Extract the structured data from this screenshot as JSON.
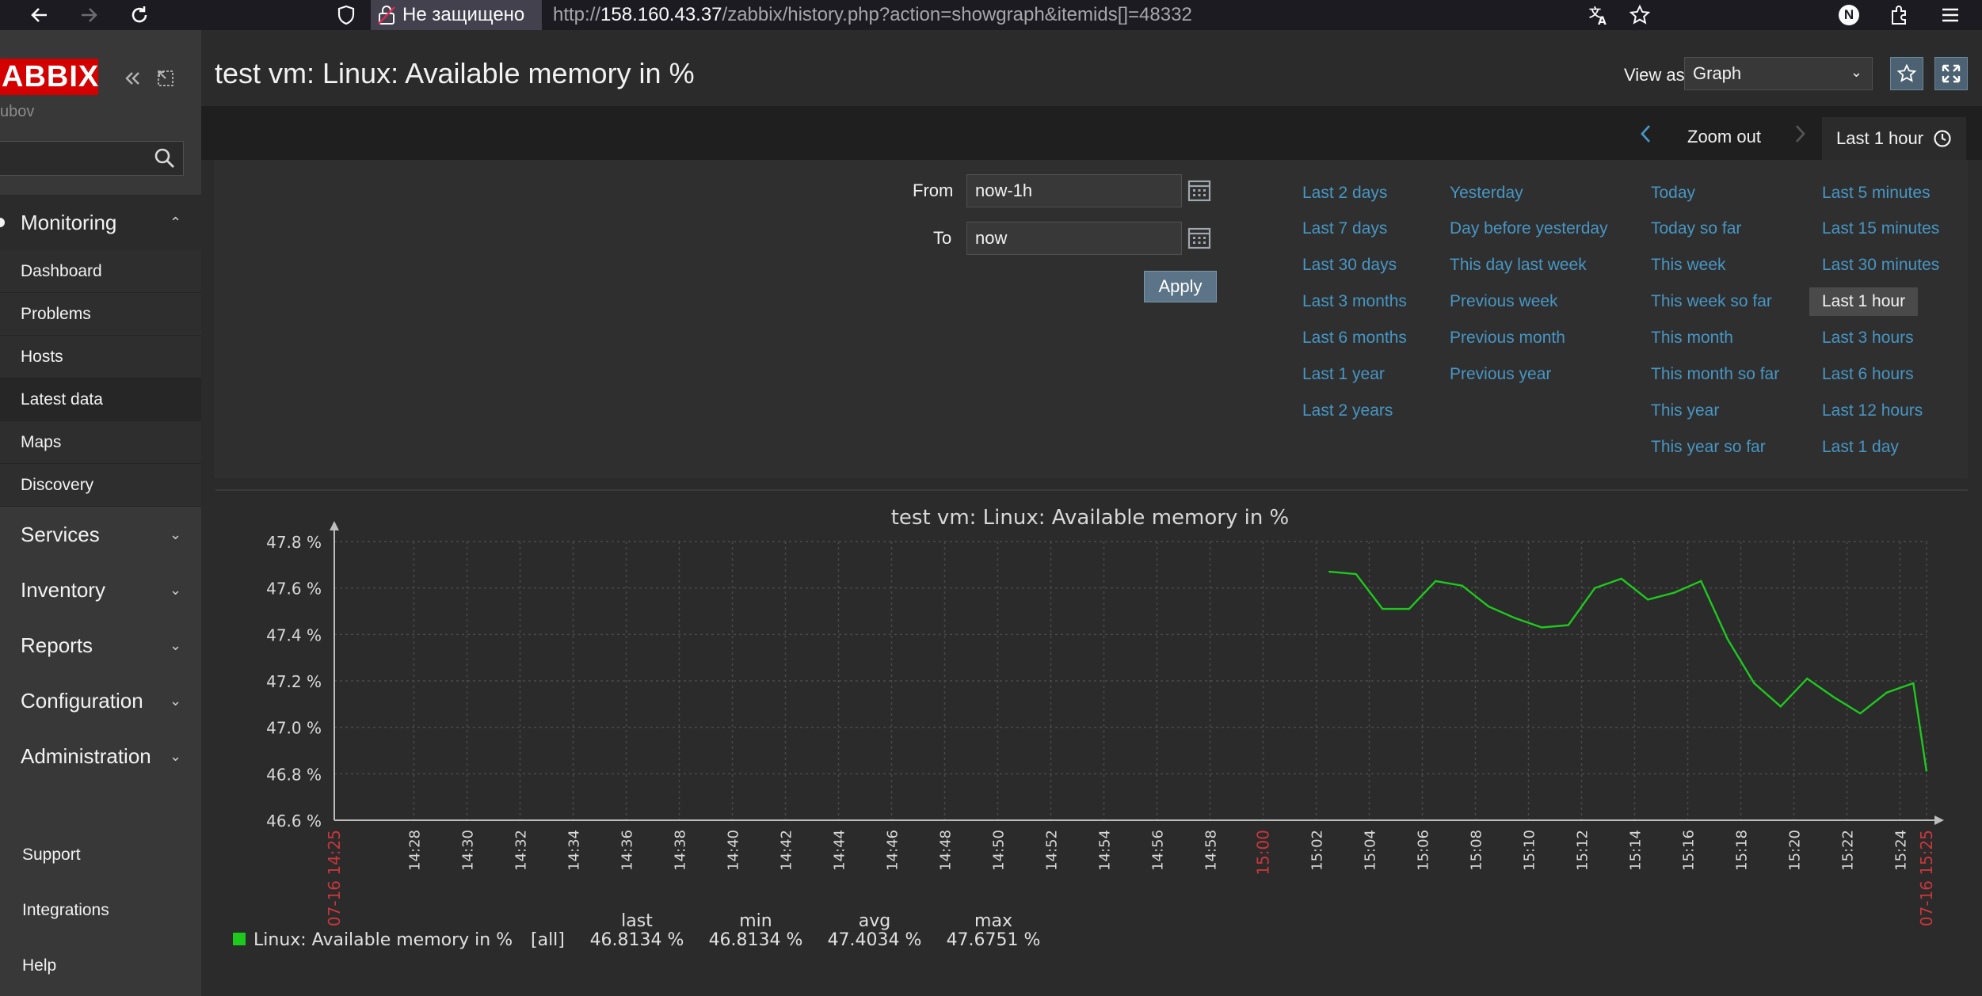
{
  "browser": {
    "security_text": "Не защищено",
    "url_host": "158.160.43.37",
    "url_prefix": "http://",
    "url_path": "/zabbix/history.php?action=showgraph&itemids[]=48332",
    "avatar_letter": "N"
  },
  "sidebar": {
    "logo": "ABBIX",
    "user": "ubov",
    "sections": [
      {
        "label": "Monitoring",
        "expanded": true
      },
      {
        "label": "Services"
      },
      {
        "label": "Inventory"
      },
      {
        "label": "Reports"
      },
      {
        "label": "Configuration"
      },
      {
        "label": "Administration"
      }
    ],
    "monitoring_items": [
      "Dashboard",
      "Problems",
      "Hosts",
      "Latest data",
      "Maps",
      "Discovery"
    ],
    "selected_item": "Latest data",
    "footer": [
      "Support",
      "Integrations",
      "Help"
    ]
  },
  "header": {
    "title": "test vm: Linux: Available memory in %",
    "view_as_label": "View as",
    "view_as_value": "Graph"
  },
  "timebar": {
    "zoom_out": "Zoom out",
    "active_tab": "Last 1 hour"
  },
  "filter": {
    "from_label": "From",
    "from_value": "now-1h",
    "to_label": "To",
    "to_value": "now",
    "apply": "Apply",
    "quick_ranges": [
      [
        "Last 2 days",
        "Last 7 days",
        "Last 30 days",
        "Last 3 months",
        "Last 6 months",
        "Last 1 year",
        "Last 2 years"
      ],
      [
        "Yesterday",
        "Day before yesterday",
        "This day last week",
        "Previous week",
        "Previous month",
        "Previous year"
      ],
      [
        "Today",
        "Today so far",
        "This week",
        "This week so far",
        "This month",
        "This month so far",
        "This year",
        "This year so far"
      ],
      [
        "Last 5 minutes",
        "Last 15 minutes",
        "Last 30 minutes",
        "Last 1 hour",
        "Last 3 hours",
        "Last 6 hours",
        "Last 12 hours",
        "Last 1 day"
      ]
    ],
    "selected_range": "Last 1 hour"
  },
  "chart_data": {
    "type": "line",
    "title": "test vm: Linux: Available memory in %",
    "ylim": [
      46.6,
      47.8
    ],
    "y_ticks": [
      "47.8 %",
      "47.6 %",
      "47.4 %",
      "47.2 %",
      "47.0 %",
      "46.8 %",
      "46.6 %"
    ],
    "x_ticks": [
      "07-16 14:25",
      "14:28",
      "14:30",
      "14:32",
      "14:34",
      "14:36",
      "14:38",
      "14:40",
      "14:42",
      "14:44",
      "14:46",
      "14:48",
      "14:50",
      "14:52",
      "14:54",
      "14:56",
      "14:58",
      "15:00",
      "15:02",
      "15:04",
      "15:06",
      "15:08",
      "15:10",
      "15:12",
      "15:14",
      "15:16",
      "15:18",
      "15:20",
      "15:22",
      "15:24",
      "07-16 15:25"
    ],
    "x_tick_minutes": [
      0,
      3,
      5,
      7,
      9,
      11,
      13,
      15,
      17,
      19,
      21,
      23,
      25,
      27,
      29,
      31,
      33,
      35,
      37,
      39,
      41,
      43,
      45,
      47,
      49,
      51,
      53,
      55,
      57,
      59,
      60
    ],
    "highlight_ticks": [
      "07-16 14:25",
      "15:00",
      "07-16 15:25"
    ],
    "grid": true,
    "series": [
      {
        "name": "Linux: Available memory in %",
        "color": "#1ec91e",
        "x_minutes": [
          37.5,
          38.5,
          39.5,
          40.5,
          41.5,
          42.5,
          43.5,
          44.5,
          45.5,
          46.5,
          47.5,
          48.5,
          49.5,
          50.5,
          51.5,
          52.5,
          53.5,
          54.5,
          55.5,
          56.5,
          57.5,
          58.5,
          59.5
        ],
        "values": [
          47.67,
          47.66,
          47.51,
          47.51,
          47.63,
          47.61,
          47.52,
          47.47,
          47.43,
          47.44,
          47.6,
          47.64,
          47.55,
          47.58,
          47.63,
          47.38,
          47.19,
          47.09,
          47.21,
          47.13,
          47.06,
          47.15,
          47.19
        ]
      }
    ],
    "last_point": {
      "x_minute": 60,
      "value": 46.81
    },
    "legend": {
      "label": "Linux: Available memory in %",
      "scope": "[all]",
      "headers": [
        "last",
        "min",
        "avg",
        "max"
      ],
      "values": [
        "46.8134 %",
        "46.8134 %",
        "47.4034 %",
        "47.6751 %"
      ]
    }
  }
}
